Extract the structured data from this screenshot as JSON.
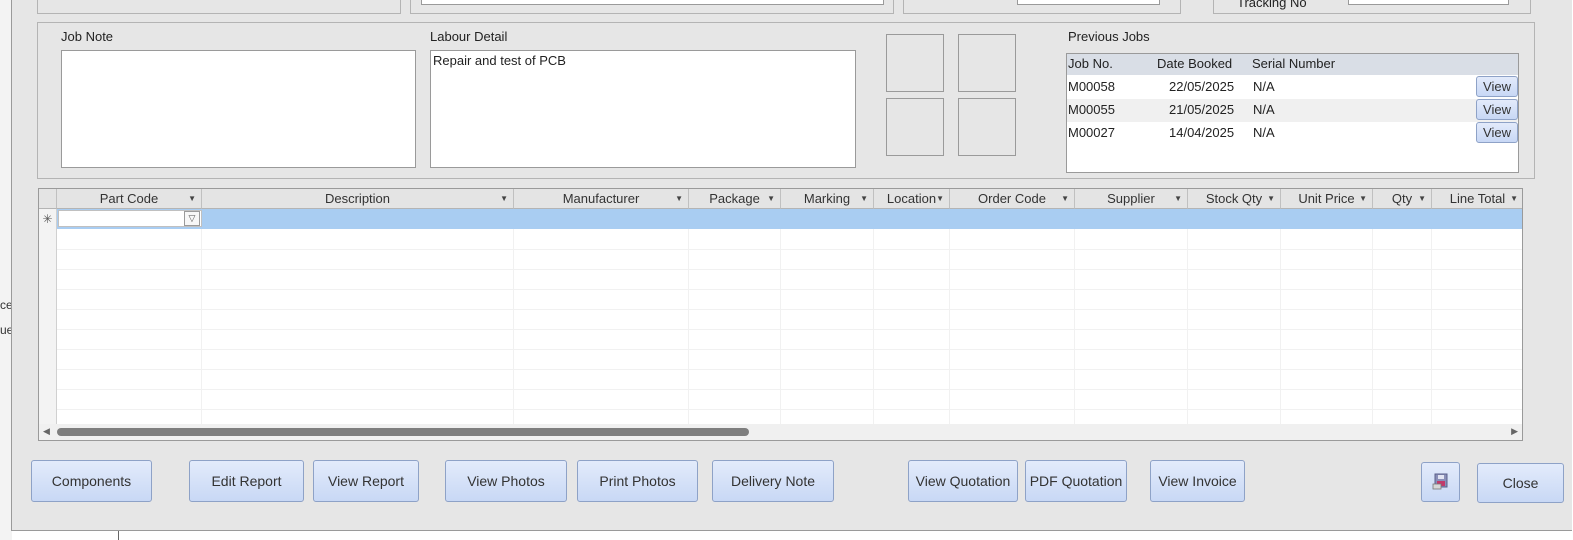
{
  "background": {
    "left_text_1": "ce",
    "left_text_2": "ue"
  },
  "top_strip": {
    "tracking_label": "Tracking No"
  },
  "job_note": {
    "label": "Job Note",
    "value": ""
  },
  "labour_detail": {
    "label": "Labour Detail",
    "value": "Repair and test of PCB"
  },
  "previous_jobs": {
    "label": "Previous Jobs",
    "columns": [
      "Job No.",
      "Date Booked",
      "Serial Number"
    ],
    "rows": [
      {
        "job_no": "M00058",
        "date": "22/05/2025",
        "serial": "N/A",
        "action": "View"
      },
      {
        "job_no": "M00055",
        "date": "21/05/2025",
        "serial": "N/A",
        "action": "View"
      },
      {
        "job_no": "M00027",
        "date": "14/04/2025",
        "serial": "N/A",
        "action": "View"
      }
    ]
  },
  "parts_grid": {
    "columns": [
      "Part Code",
      "Description",
      "Manufacturer",
      "Package",
      "Marking",
      "Location",
      "Order Code",
      "Supplier",
      "Stock Qty",
      "Unit Price",
      "Qty",
      "Line Total"
    ],
    "new_row_marker": "✳",
    "rows": []
  },
  "buttons": {
    "components": "Components",
    "edit_report": "Edit Report",
    "view_report": "View Report",
    "view_photos": "View Photos",
    "print_photos": "Print Photos",
    "delivery_note": "Delivery Note",
    "view_quotation": "View Quotation",
    "pdf_quotation": "PDF Quotation",
    "view_invoice": "View Invoice",
    "save_icon": "save-icon",
    "close": "Close"
  },
  "colors": {
    "form_bg": "#e6e6e6",
    "button_top": "#e3ebfb",
    "button_bottom": "#c8d8f5",
    "selected_row": "#a9cdf2"
  }
}
